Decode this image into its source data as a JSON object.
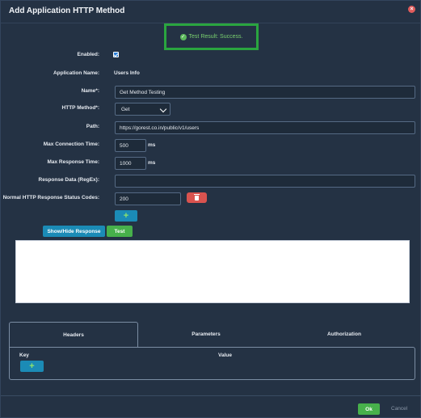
{
  "dialog": {
    "title": "Add Application HTTP Method"
  },
  "test_result": {
    "text": "Test Result: Success."
  },
  "form": {
    "enabled_label": "Enabled:",
    "enabled_checked": true,
    "application_name_label": "Application Name:",
    "application_name_value": "Users Info",
    "name_label": "Name*:",
    "name_value": "Get Method Testing",
    "http_method_label": "HTTP Method*:",
    "http_method_value": "Get",
    "path_label": "Path:",
    "path_value": "https://gorest.co.in/public/v1/users",
    "max_connection_label": "Max Connection Time:",
    "max_connection_value": "500",
    "max_connection_unit": "ms",
    "max_response_label": "Max Response Time:",
    "max_response_value": "1000",
    "max_response_unit": "ms",
    "response_data_label": "Response Data (RegEx):",
    "response_data_value": "",
    "status_codes_label": "Normal HTTP Response Status Codes:",
    "status_codes_value": "200"
  },
  "buttons": {
    "add_status_code": "+",
    "show_hide_response": "Show/Hide Response",
    "test": "Test",
    "add_header": "+",
    "ok": "Ok",
    "cancel": "Cancel"
  },
  "tabs": [
    {
      "label": "Headers",
      "active": true
    },
    {
      "label": "Parameters",
      "active": false
    },
    {
      "label": "Authorization",
      "active": false
    }
  ],
  "headers_table": {
    "key_header": "Key",
    "value_header": "Value"
  },
  "colors": {
    "background": "#243244",
    "success": "#2aa53f",
    "primary": "#1b8bb6",
    "danger": "#d9534f",
    "ok": "#47b04b"
  }
}
